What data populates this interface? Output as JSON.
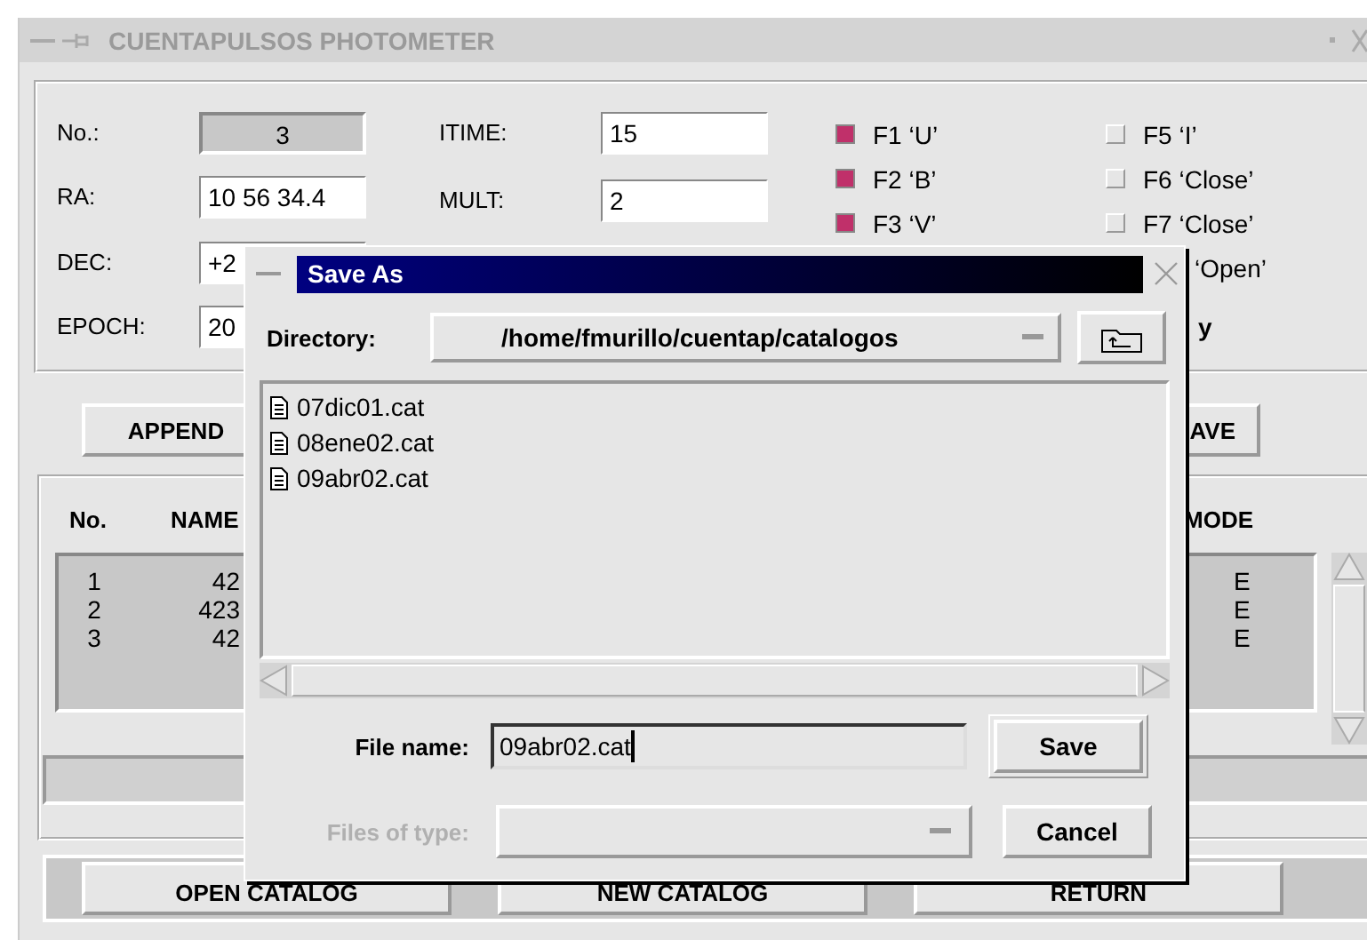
{
  "window": {
    "title": "CUENTAPULSOS PHOTOMETER"
  },
  "fields": [
    {
      "label": "No.:",
      "value": "3",
      "kind": "readonly"
    },
    {
      "label": "RA:",
      "value": "10 56 34.4",
      "kind": "input"
    },
    {
      "label": "DEC:",
      "value": "+2",
      "kind": "input"
    },
    {
      "label": "EPOCH:",
      "value": "20",
      "kind": "input"
    }
  ],
  "fields_2": [
    {
      "label": "ITIME:",
      "value": "15"
    },
    {
      "label": "MULT:",
      "value": "2"
    }
  ],
  "filters": [
    [
      {
        "label": "F1 ‘U’",
        "kind": "check",
        "checked": true
      },
      {
        "label": "F2 ‘B’",
        "kind": "check",
        "checked": true
      },
      {
        "label": "F3 ‘V’",
        "kind": "check",
        "checked": true
      }
    ],
    [
      {
        "label": "F5 ‘I’",
        "kind": "check",
        "checked": false
      },
      {
        "label": "F6 ‘Close’",
        "kind": "check",
        "checked": false
      },
      {
        "label": "F7 ‘Close’",
        "kind": "check",
        "checked": false
      },
      {
        "label": "‘Open’",
        "kind": "cut"
      },
      {
        "label": "y",
        "kind": "bold"
      }
    ]
  ],
  "buttons": [
    "APPEND",
    "AVE"
  ],
  "table": {
    "columns": [
      "No.",
      "NAME",
      "MODE"
    ],
    "rows": [
      [
        "1",
        "42",
        "E"
      ],
      [
        "2",
        "423",
        "E"
      ],
      [
        "3",
        "42",
        "E"
      ]
    ]
  },
  "bottom_buttons": [
    "OPEN CATALOG",
    "NEW CATALOG",
    "RETURN"
  ],
  "dialog": {
    "title": "Save As",
    "directory_label": "Directory:",
    "directory": "/home/fmurillo/cuentap/catalogos",
    "files": [
      "07dic01.cat",
      "08ene02.cat",
      "09abr02.cat"
    ],
    "file_name_label": "File name:",
    "file_name": "09abr02.cat",
    "type_label": "Files of type:",
    "type_disabled": true,
    "buttons": [
      "Save",
      "Cancel"
    ]
  }
}
